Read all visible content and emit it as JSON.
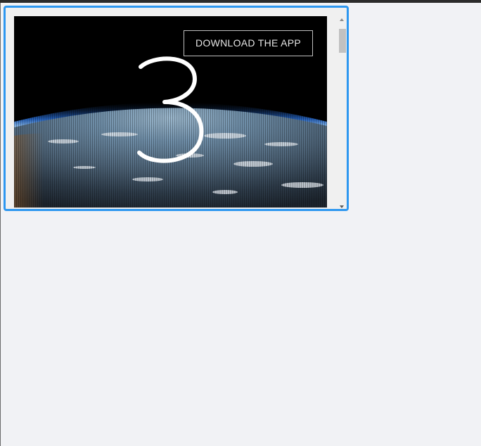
{
  "embed": {
    "download_label": "DOWNLOAD THE APP",
    "countdown_value": "3",
    "background_image": "earth-from-orbit"
  },
  "colors": {
    "focus_border": "#2d97f0",
    "page_background": "#f1f2f5",
    "button_border": "#ffffff",
    "countdown_text": "#ffffff"
  },
  "scrollbar": {
    "up_icon": "scroll-up-arrow-icon",
    "down_icon": "scroll-down-arrow-icon"
  }
}
